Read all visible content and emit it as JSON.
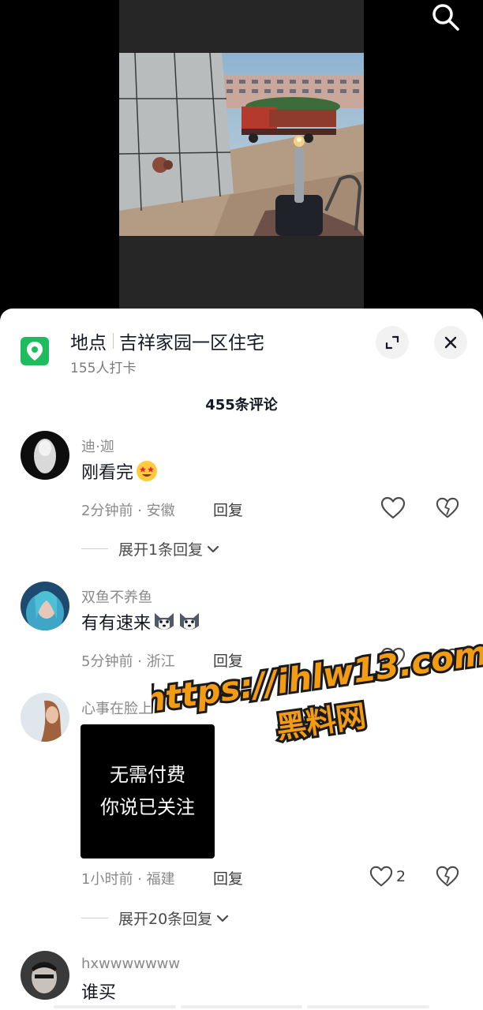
{
  "video": {
    "search_icon": "search-icon"
  },
  "location": {
    "label": "地点",
    "name": "吉祥家园一区住宅",
    "checkins": "155人打卡",
    "icon": "location-pin-icon",
    "accent": "#1dbd5f"
  },
  "comment_count": "455条评论",
  "comments": [
    {
      "user": "迪·迦",
      "text": "刚看完",
      "emoji": "star-struck-emoji",
      "meta": "2分钟前 · 安徽",
      "reply_label": "回复",
      "likes": "",
      "expand": "展开1条回复"
    },
    {
      "user": "双鱼不养鱼",
      "text": "有有速来",
      "emoji": "husky-emoji",
      "meta": "5分钟前 · 浙江",
      "reply_label": "回复",
      "likes": ""
    },
    {
      "user": "心事在脸上",
      "image_text_line1": "无需付费",
      "image_text_line2": "你说已关注",
      "meta": "1小时前 · 福建",
      "reply_label": "回复",
      "likes": "2",
      "expand": "展开20条回复"
    },
    {
      "user": "hxwwwwwww",
      "text": "谁买"
    }
  ],
  "watermark": {
    "url": "https://ihlw13.com",
    "name": "黑料网",
    "fill": "#f39c12",
    "outline": "#1a1a1a"
  }
}
